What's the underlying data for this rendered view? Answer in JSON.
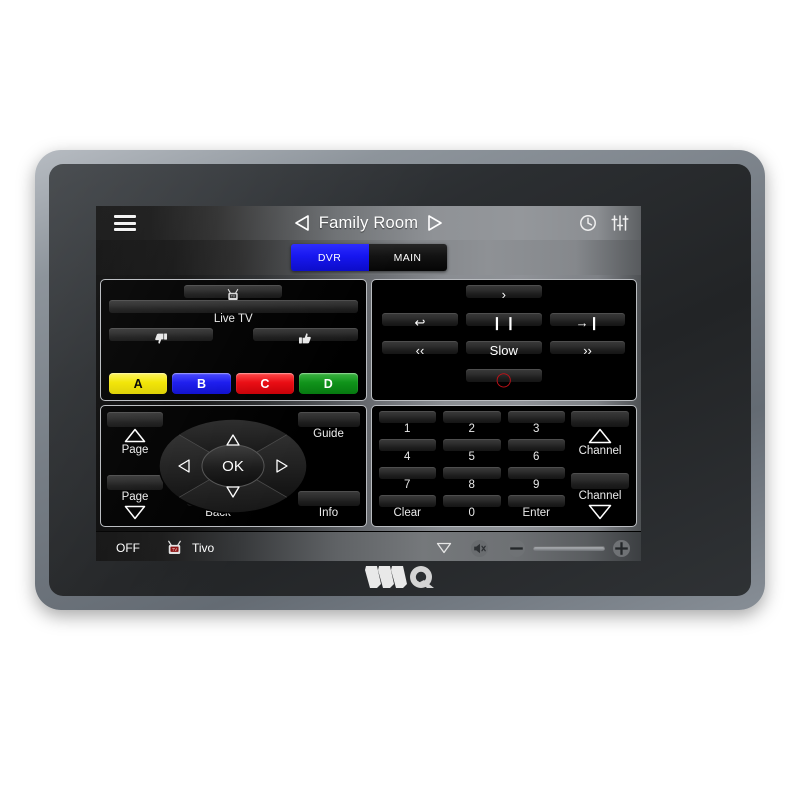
{
  "header": {
    "menu_icon": "hamburger-menu-icon",
    "prev_icon": "previous-room-arrow",
    "title": "Family Room",
    "next_icon": "next-room-arrow",
    "clock_icon": "clock-icon",
    "settings_icon": "sliders-icon"
  },
  "tabs": [
    {
      "label": "DVR",
      "active": true
    },
    {
      "label": "MAIN",
      "active": false
    }
  ],
  "live_panel": {
    "tivo_button": {
      "icon": "tivo-logo-icon",
      "label": ""
    },
    "livetv_button": {
      "label": "Live TV"
    },
    "thumbs_down": {
      "icon": "thumbs-down-icon"
    },
    "thumbs_up": {
      "icon": "thumbs-up-icon"
    },
    "color_buttons": [
      {
        "label": "A",
        "color": "#f2e500",
        "text_color": "#000000"
      },
      {
        "label": "B",
        "color": "#1414ee",
        "text_color": "#ffffff"
      },
      {
        "label": "C",
        "color": "#ea0b12",
        "text_color": "#ffffff"
      },
      {
        "label": "D",
        "color": "#0f8c16",
        "text_color": "#ffffff"
      }
    ]
  },
  "transport_panel": {
    "play": {
      "label": "›",
      "name": "play-button"
    },
    "replay": {
      "label": "↩",
      "name": "replay-button"
    },
    "pause": {
      "label": "❙ ❙",
      "name": "pause-button"
    },
    "skip": {
      "label": "→❙",
      "name": "skip-forward-button"
    },
    "rewind": {
      "label": "‹‹",
      "name": "rewind-button"
    },
    "slow": {
      "label": "Slow",
      "name": "slow-button"
    },
    "forward": {
      "label": "››",
      "name": "fast-forward-button"
    },
    "record": {
      "label": "◯",
      "name": "record-button",
      "color": "#c31018"
    }
  },
  "dpad_panel": {
    "page_up": {
      "label": "Page",
      "icon": "triangle-up-icon"
    },
    "page_down": {
      "label": "Page",
      "icon": "triangle-down-icon"
    },
    "guide": {
      "label": "Guide"
    },
    "back": {
      "label": "Back"
    },
    "info": {
      "label": "Info"
    },
    "ok": {
      "label": "OK"
    },
    "up": {
      "icon": "arrow-up-icon"
    },
    "down": {
      "icon": "arrow-down-icon"
    },
    "left": {
      "icon": "arrow-left-icon"
    },
    "right": {
      "icon": "arrow-right-icon"
    }
  },
  "keypad_panel": {
    "keys": [
      "1",
      "2",
      "3",
      "4",
      "5",
      "6",
      "7",
      "8",
      "9",
      "Clear",
      "0",
      "Enter"
    ],
    "channel_up": {
      "label": "Channel",
      "icon": "triangle-up-icon"
    },
    "channel_down": {
      "label": "Channel",
      "icon": "triangle-down-icon"
    }
  },
  "bottom_bar": {
    "off_label": "OFF",
    "device_icon": "tivo-logo-icon",
    "device_name": "Tivo",
    "dropdown_icon": "triangle-down-icon",
    "mute_icon": "mute-speaker-icon",
    "volume_down_icon": "volume-minus-icon",
    "volume_up_icon": "volume-plus-icon"
  },
  "device": {
    "brand_logo": "wq-brand-logo"
  }
}
